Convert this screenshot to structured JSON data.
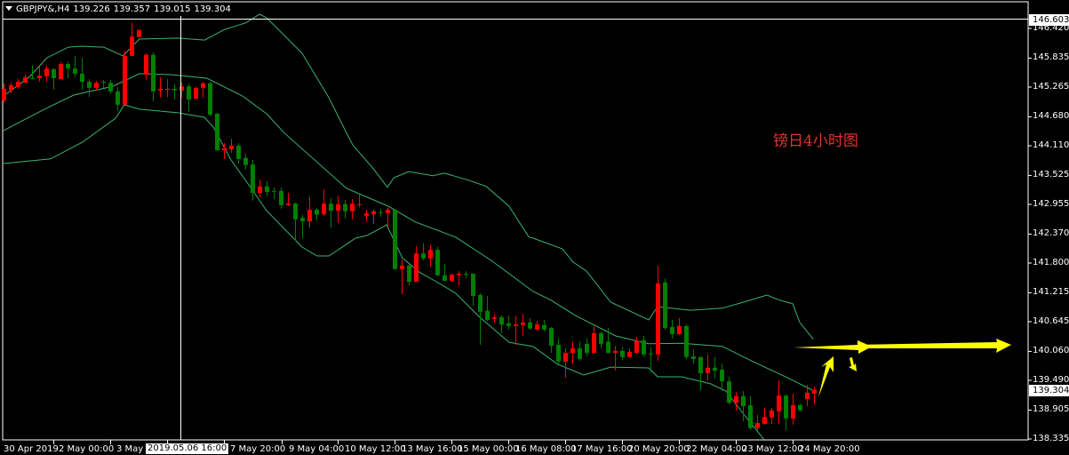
{
  "header": {
    "symbol": "GBPJPY&,H4",
    "open": "139.226",
    "high": "139.357",
    "low": "139.015",
    "close": "139.304"
  },
  "annotation": "镑日4小时图",
  "price_axis": {
    "labels": [
      "146.420",
      "145.835",
      "145.265",
      "144.680",
      "144.110",
      "143.525",
      "142.955",
      "142.370",
      "141.800",
      "141.215",
      "140.645",
      "140.060",
      "139.490",
      "138.905",
      "138.335"
    ],
    "crosshair_price": "146.603",
    "current_price": "139.304"
  },
  "time_axis": {
    "labels": [
      "30 Apr 2019",
      "2 May 00:00",
      "3 May",
      "7 May 20:00",
      "9 May 04:00",
      "10 May 12:00",
      "13 May 16:00",
      "15 May 00:00",
      "16 May 08:00",
      "17 May 16:00",
      "20 May 20:00",
      "22 May 04:00",
      "23 May 12:00",
      "24 May 20:00"
    ],
    "crosshair_time": "2019.05.06 16:00"
  },
  "colors": {
    "bull": "#ff0000",
    "bear": "#008000",
    "bands": "#3cb371",
    "arrows": "#ffff00",
    "annotation": "#e03232"
  },
  "chart_data": {
    "type": "candlestick",
    "symbol": "GBPJPY&",
    "timeframe": "H4",
    "ylim": [
      138.335,
      146.603
    ],
    "candles_ohlc": [
      [
        145.0,
        145.34,
        144.97,
        145.23
      ],
      [
        145.2,
        145.35,
        145.14,
        145.3
      ],
      [
        145.27,
        145.42,
        145.23,
        145.37
      ],
      [
        145.35,
        145.51,
        145.35,
        145.46
      ],
      [
        145.44,
        145.7,
        145.42,
        145.43
      ],
      [
        145.44,
        145.67,
        145.37,
        145.49
      ],
      [
        145.48,
        145.69,
        145.37,
        145.63
      ],
      [
        145.62,
        145.63,
        145.21,
        145.44
      ],
      [
        145.42,
        145.76,
        145.42,
        145.72
      ],
      [
        145.72,
        145.77,
        145.44,
        145.63
      ],
      [
        145.63,
        145.88,
        145.46,
        145.53
      ],
      [
        145.53,
        145.84,
        145.21,
        145.37
      ],
      [
        145.37,
        145.42,
        145.07,
        145.25
      ],
      [
        145.25,
        145.39,
        145.2,
        145.35
      ],
      [
        145.37,
        145.41,
        145.25,
        145.36
      ],
      [
        145.35,
        145.41,
        145.13,
        145.18
      ],
      [
        145.18,
        145.27,
        144.79,
        144.92
      ],
      [
        144.92,
        145.98,
        144.92,
        145.88
      ],
      [
        145.88,
        146.53,
        145.88,
        146.26
      ],
      [
        146.25,
        146.4,
        146.25,
        146.39
      ],
      [
        145.51,
        145.93,
        145.41,
        145.9
      ],
      [
        145.9,
        145.95,
        144.99,
        145.18
      ],
      [
        145.2,
        145.46,
        145.06,
        145.23
      ],
      [
        145.21,
        145.42,
        145.07,
        145.23
      ],
      [
        145.23,
        145.32,
        145.02,
        145.2
      ],
      [
        145.2,
        145.35,
        145.06,
        145.28
      ],
      [
        145.28,
        145.34,
        144.78,
        145.02
      ],
      [
        145.04,
        145.27,
        145.02,
        145.25
      ],
      [
        145.25,
        145.37,
        145.06,
        145.34
      ],
      [
        145.34,
        145.37,
        144.69,
        144.72
      ],
      [
        144.74,
        144.76,
        144.01,
        144.02
      ],
      [
        144.02,
        144.16,
        143.85,
        144.06
      ],
      [
        144.04,
        144.25,
        143.97,
        144.11
      ],
      [
        144.11,
        144.16,
        143.76,
        143.85
      ],
      [
        143.87,
        143.95,
        143.64,
        143.73
      ],
      [
        143.74,
        143.83,
        143.03,
        143.18
      ],
      [
        143.18,
        143.45,
        143.1,
        143.31
      ],
      [
        143.31,
        143.41,
        143.11,
        143.2
      ],
      [
        143.22,
        143.29,
        143.06,
        143.21
      ],
      [
        143.22,
        143.29,
        142.87,
        142.94
      ],
      [
        142.94,
        143.18,
        142.92,
        142.97
      ],
      [
        142.97,
        142.99,
        142.24,
        142.66
      ],
      [
        142.69,
        142.75,
        142.29,
        142.62
      ],
      [
        142.62,
        143.1,
        142.5,
        142.85
      ],
      [
        142.85,
        142.89,
        142.64,
        142.75
      ],
      [
        142.76,
        143.25,
        142.73,
        142.97
      ],
      [
        142.97,
        143.08,
        142.5,
        142.83
      ],
      [
        142.83,
        143.13,
        142.59,
        142.96
      ],
      [
        142.96,
        143.04,
        142.68,
        142.82
      ],
      [
        142.82,
        143.06,
        142.66,
        142.97
      ],
      [
        142.95,
        143.15,
        142.9,
        142.96
      ],
      [
        142.73,
        142.85,
        142.61,
        142.78
      ],
      [
        142.76,
        142.85,
        142.57,
        142.82
      ],
      [
        142.8,
        142.87,
        142.71,
        142.79
      ],
      [
        142.78,
        142.89,
        142.52,
        142.85
      ],
      [
        142.85,
        142.87,
        141.68,
        141.68
      ],
      [
        141.68,
        141.87,
        141.19,
        141.75
      ],
      [
        141.75,
        141.78,
        141.36,
        141.43
      ],
      [
        141.43,
        142.13,
        141.43,
        141.99
      ],
      [
        141.99,
        142.19,
        141.85,
        141.89
      ],
      [
        141.89,
        142.15,
        141.73,
        142.06
      ],
      [
        142.06,
        142.12,
        141.54,
        141.56
      ],
      [
        141.56,
        141.78,
        141.45,
        141.45
      ],
      [
        141.45,
        141.59,
        141.43,
        141.57
      ],
      [
        141.56,
        141.64,
        141.35,
        141.59
      ],
      [
        141.59,
        141.64,
        141.5,
        141.58
      ],
      [
        141.59,
        141.59,
        140.96,
        141.15
      ],
      [
        141.17,
        141.21,
        140.19,
        140.84
      ],
      [
        140.86,
        141.15,
        140.66,
        140.68
      ],
      [
        140.7,
        140.79,
        140.63,
        140.73
      ],
      [
        140.73,
        140.77,
        140.42,
        140.59
      ],
      [
        140.61,
        140.77,
        140.49,
        140.56
      ],
      [
        140.56,
        140.75,
        140.19,
        140.59
      ],
      [
        140.58,
        140.8,
        140.37,
        140.63
      ],
      [
        140.63,
        140.72,
        140.49,
        140.51
      ],
      [
        140.49,
        140.66,
        140.47,
        140.59
      ],
      [
        140.58,
        140.68,
        140.45,
        140.49
      ],
      [
        140.52,
        140.54,
        140.03,
        140.17
      ],
      [
        140.19,
        140.31,
        139.81,
        139.86
      ],
      [
        139.86,
        140.12,
        139.54,
        140.03
      ],
      [
        140.03,
        140.25,
        139.81,
        140.12
      ],
      [
        140.12,
        140.25,
        139.88,
        139.91
      ],
      [
        140.21,
        140.31,
        139.96,
        140.03
      ],
      [
        140.03,
        140.56,
        140.02,
        140.42
      ],
      [
        140.42,
        140.45,
        140.12,
        140.21
      ],
      [
        140.25,
        140.52,
        140.02,
        140.03
      ],
      [
        140.03,
        140.17,
        139.68,
        140.07
      ],
      [
        140.07,
        140.14,
        139.89,
        139.95
      ],
      [
        139.95,
        140.12,
        139.95,
        140.05
      ],
      [
        140.03,
        140.35,
        140.03,
        140.26
      ],
      [
        140.28,
        140.37,
        139.96,
        140.0
      ],
      [
        140.02,
        140.14,
        139.65,
        140.01
      ],
      [
        140.0,
        141.75,
        139.88,
        141.4
      ],
      [
        141.42,
        141.49,
        140.49,
        140.52
      ],
      [
        140.54,
        140.68,
        140.31,
        140.4
      ],
      [
        140.4,
        140.72,
        140.38,
        140.56
      ],
      [
        140.56,
        140.59,
        139.91,
        139.95
      ],
      [
        139.96,
        140.1,
        139.82,
        139.91
      ],
      [
        139.95,
        139.95,
        139.3,
        139.63
      ],
      [
        139.63,
        140.0,
        139.49,
        139.74
      ],
      [
        139.74,
        139.95,
        139.53,
        139.68
      ],
      [
        139.7,
        139.82,
        139.28,
        139.47
      ],
      [
        139.47,
        139.56,
        139.02,
        139.05
      ],
      [
        139.05,
        139.26,
        138.9,
        139.18
      ],
      [
        139.18,
        139.28,
        138.69,
        138.98
      ],
      [
        139.0,
        139.18,
        138.51,
        138.55
      ],
      [
        138.55,
        138.81,
        138.5,
        138.65
      ],
      [
        138.63,
        138.95,
        138.62,
        138.77
      ],
      [
        138.76,
        138.95,
        138.63,
        138.9
      ],
      [
        138.88,
        139.49,
        138.63,
        139.19
      ],
      [
        139.19,
        139.21,
        138.5,
        138.74
      ],
      [
        138.74,
        139.23,
        138.62,
        139.0
      ],
      [
        139.0,
        139.04,
        138.88,
        138.9
      ],
      [
        139.12,
        139.4,
        138.98,
        139.25
      ],
      [
        139.226,
        139.357,
        139.015,
        139.304
      ]
    ],
    "bollinger_bands": {
      "upper": [
        [
          0,
          145.09
        ],
        [
          3.6,
          145.46
        ],
        [
          6.1,
          145.84
        ],
        [
          9.1,
          146.05
        ],
        [
          10.8,
          146.07
        ],
        [
          14.1,
          146.05
        ],
        [
          16.8,
          145.88
        ],
        [
          19.1,
          146.21
        ],
        [
          24.5,
          146.23
        ],
        [
          28.3,
          146.19
        ],
        [
          31.1,
          146.4
        ],
        [
          34.1,
          146.53
        ],
        [
          36,
          146.7
        ],
        [
          37,
          146.63
        ],
        [
          42,
          145.93
        ],
        [
          45.75,
          145.06
        ],
        [
          48.25,
          144.36
        ],
        [
          49.1,
          144.13
        ],
        [
          52,
          143.66
        ],
        [
          54,
          143.29
        ],
        [
          54.9,
          143.48
        ],
        [
          57,
          143.6
        ],
        [
          60.4,
          143.52
        ],
        [
          62,
          143.57
        ],
        [
          65.4,
          143.43
        ],
        [
          67.9,
          143.31
        ],
        [
          71.1,
          142.92
        ],
        [
          73.9,
          142.31
        ],
        [
          74.5,
          142.29
        ],
        [
          78.6,
          142.08
        ],
        [
          80.1,
          141.82
        ],
        [
          82,
          141.64
        ],
        [
          85.4,
          141.03
        ],
        [
          90.75,
          140.68
        ],
        [
          92,
          140.94
        ],
        [
          96.6,
          140.87
        ],
        [
          101.1,
          140.91
        ],
        [
          103.6,
          141.01
        ],
        [
          107.4,
          141.17
        ],
        [
          109.1,
          141.07
        ],
        [
          111,
          141.0
        ],
        [
          112,
          140.63
        ],
        [
          113.9,
          140.3
        ]
      ],
      "middle": [
        [
          0,
          144.41
        ],
        [
          5.75,
          144.83
        ],
        [
          9.9,
          145.11
        ],
        [
          15.4,
          145.28
        ],
        [
          19.1,
          145.53
        ],
        [
          23.6,
          145.51
        ],
        [
          28.6,
          145.44
        ],
        [
          33.6,
          145.09
        ],
        [
          37,
          144.74
        ],
        [
          39.5,
          144.36
        ],
        [
          48.25,
          143.27
        ],
        [
          54.1,
          142.92
        ],
        [
          57.9,
          142.61
        ],
        [
          63.6,
          142.31
        ],
        [
          68.6,
          141.85
        ],
        [
          74.5,
          141.24
        ],
        [
          77,
          141.07
        ],
        [
          80.4,
          140.77
        ],
        [
          86.1,
          140.365
        ],
        [
          90.75,
          140.21
        ],
        [
          95.4,
          140.22
        ],
        [
          101.1,
          140.16
        ],
        [
          105.4,
          139.86
        ],
        [
          110.75,
          139.51
        ],
        [
          114,
          139.28
        ]
      ],
      "lower": [
        [
          0,
          143.76
        ],
        [
          6.6,
          143.85
        ],
        [
          11.1,
          144.18
        ],
        [
          15.75,
          144.65
        ],
        [
          17,
          144.915
        ],
        [
          19.1,
          144.83
        ],
        [
          24.5,
          144.76
        ],
        [
          28.25,
          144.67
        ],
        [
          29.5,
          144.48
        ],
        [
          32,
          143.83
        ],
        [
          34.5,
          143.34
        ],
        [
          37,
          142.83
        ],
        [
          42,
          142.115
        ],
        [
          44.1,
          141.94
        ],
        [
          45.75,
          141.94
        ],
        [
          48.25,
          142.17
        ],
        [
          49.5,
          142.29
        ],
        [
          51.1,
          142.34
        ],
        [
          53.9,
          142.55
        ],
        [
          56.1,
          141.9
        ],
        [
          58.6,
          141.61
        ],
        [
          61.1,
          141.415
        ],
        [
          63.6,
          141.205
        ],
        [
          67,
          140.73
        ],
        [
          71.1,
          140.24
        ],
        [
          74.5,
          140.155
        ],
        [
          77.9,
          139.81
        ],
        [
          81.6,
          139.595
        ],
        [
          85.4,
          139.75
        ],
        [
          90.75,
          139.735
        ],
        [
          92,
          139.56
        ],
        [
          95.4,
          139.56
        ],
        [
          99.5,
          139.42
        ],
        [
          101.6,
          139.28
        ],
        [
          104.5,
          138.755
        ],
        [
          107,
          138.32
        ]
      ]
    }
  }
}
